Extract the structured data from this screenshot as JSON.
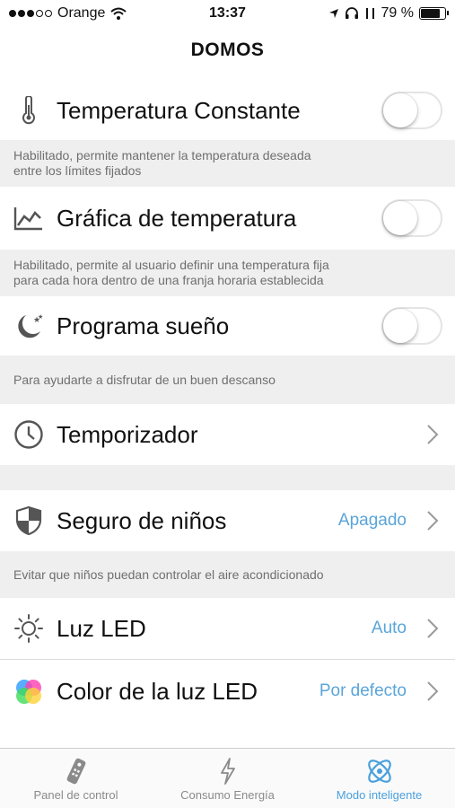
{
  "status_bar": {
    "carrier": "Orange",
    "time": "13:37",
    "battery": "79 %",
    "battery_level": 0.79
  },
  "header": {
    "title": "DOMOS"
  },
  "settings": [
    {
      "label": "Temperatura Constante",
      "icon": "thermometer-icon",
      "toggle": false,
      "description": [
        "Habilitado, permite mantener la temperatura deseada",
        "entre los límites fijados"
      ]
    },
    {
      "label": "Gráfica de temperatura",
      "icon": "chart-icon",
      "toggle": false,
      "description": [
        "Habilitado, permite al usuario definir una temperatura fija",
        "para cada hora dentro de una franja horaria establecida"
      ]
    },
    {
      "label": "Programa sueño",
      "icon": "moon-stars-icon",
      "toggle": false,
      "description": [
        "Para ayudarte a disfrutar de un buen descanso"
      ]
    },
    {
      "label": "Temporizador",
      "icon": "clock-icon"
    },
    {
      "label": "Seguro de niños",
      "icon": "shield-icon",
      "value": "Apagado",
      "description": [
        "Evitar que niños puedan controlar el aire acondicionado"
      ]
    },
    {
      "label": "Luz LED",
      "icon": "sun-icon",
      "value": "Auto"
    },
    {
      "label": "Color de la luz LED",
      "icon": "color-wheel-icon",
      "value": "Por defecto"
    }
  ],
  "tab_bar": [
    {
      "label": "Panel de control",
      "icon": "remote-icon",
      "active": false
    },
    {
      "label": "Consumo Energía",
      "icon": "lightning-icon",
      "active": false
    },
    {
      "label": "Modo inteligente",
      "icon": "atom-icon",
      "active": true
    }
  ],
  "colors": {
    "accent": "#4aa0dd",
    "value_text": "#5aa5d9",
    "section_bg": "#efeff0"
  }
}
